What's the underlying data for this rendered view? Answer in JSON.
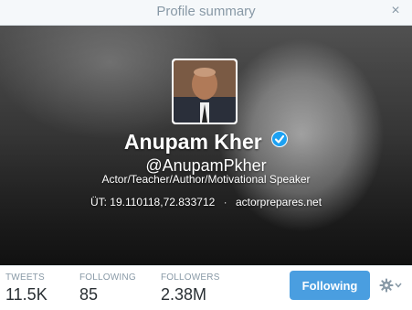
{
  "dialog": {
    "title": "Profile summary",
    "close_label": "×"
  },
  "profile": {
    "name": "Anupam Kher",
    "handle": "@AnupamPkher",
    "bio": "Actor/Teacher/Author/Motivational Speaker",
    "location": "ÜT: 19.110118,72.833712",
    "separator": "·",
    "website": "actorprepares.net",
    "verified": true
  },
  "stats": [
    {
      "label": "TWEETS",
      "value": "11.5K"
    },
    {
      "label": "FOLLOWING",
      "value": "85"
    },
    {
      "label": "FOLLOWERS",
      "value": "2.38M"
    }
  ],
  "actions": {
    "follow_label": "Following",
    "settings_icon": "gear-icon"
  },
  "colors": {
    "accent": "#4a9ee0",
    "verified_badge": "#1da1f2",
    "muted_text": "#8899a6"
  }
}
